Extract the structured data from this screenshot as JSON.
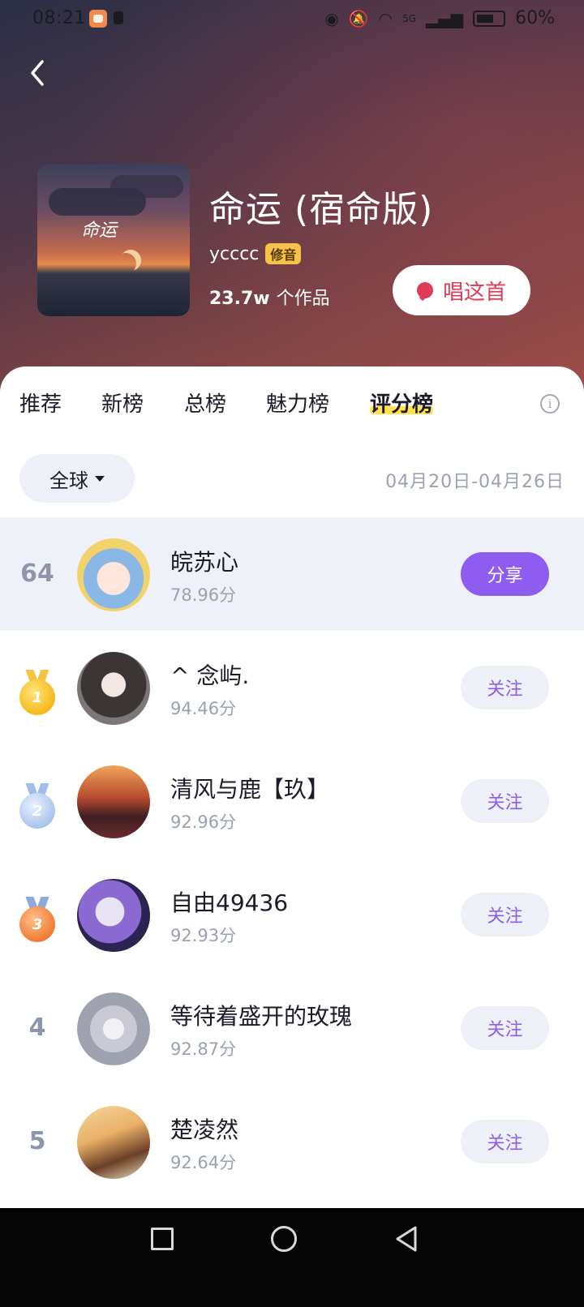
{
  "status_bar": {
    "time": "08:21",
    "network": "5G",
    "battery": "60%",
    "icons": [
      "eye-icon",
      "bell-muted-icon",
      "wifi-icon",
      "signal-icon",
      "battery-icon"
    ]
  },
  "header": {
    "back_icon": "chevron-left-icon",
    "cover_text": "命运",
    "song_title": "命运 (宿命版)",
    "artist": "ycccc",
    "artist_tag": "修音",
    "works_count": "23.7w",
    "works_label": "个作品",
    "sing_button_label": "唱这首",
    "sing_icon": "microphone-icon"
  },
  "tabs": [
    {
      "label": "推荐",
      "active": false
    },
    {
      "label": "新榜",
      "active": false
    },
    {
      "label": "总榜",
      "active": false
    },
    {
      "label": "魅力榜",
      "active": false
    },
    {
      "label": "评分榜",
      "active": true
    }
  ],
  "info_icon_glyph": "i",
  "filter": {
    "region": "全球",
    "date_range": "04月20日-04月26日"
  },
  "my_rank": {
    "rank": "64",
    "name": "皖苏心",
    "score": "78.96分",
    "action": "分享"
  },
  "leaderboard": [
    {
      "rank": "1",
      "medal": "gold",
      "name": "^ 念屿.",
      "score": "94.46分",
      "action": "关注"
    },
    {
      "rank": "2",
      "medal": "silver",
      "name": "清风与鹿【玖】",
      "score": "92.96分",
      "action": "关注"
    },
    {
      "rank": "3",
      "medal": "bronze",
      "name": "自由49436",
      "score": "92.93分",
      "action": "关注"
    },
    {
      "rank": "4",
      "medal": "",
      "name": "等待着盛开的玫瑰",
      "score": "92.87分",
      "action": "关注"
    },
    {
      "rank": "5",
      "medal": "",
      "name": "楚凌然",
      "score": "92.64分",
      "action": "关注"
    }
  ],
  "colors": {
    "accent_purple": "#8f5cf0",
    "sing_red": "#e13b58",
    "tab_highlight": "#ffe34d",
    "muted_text": "#9aa1b4"
  }
}
